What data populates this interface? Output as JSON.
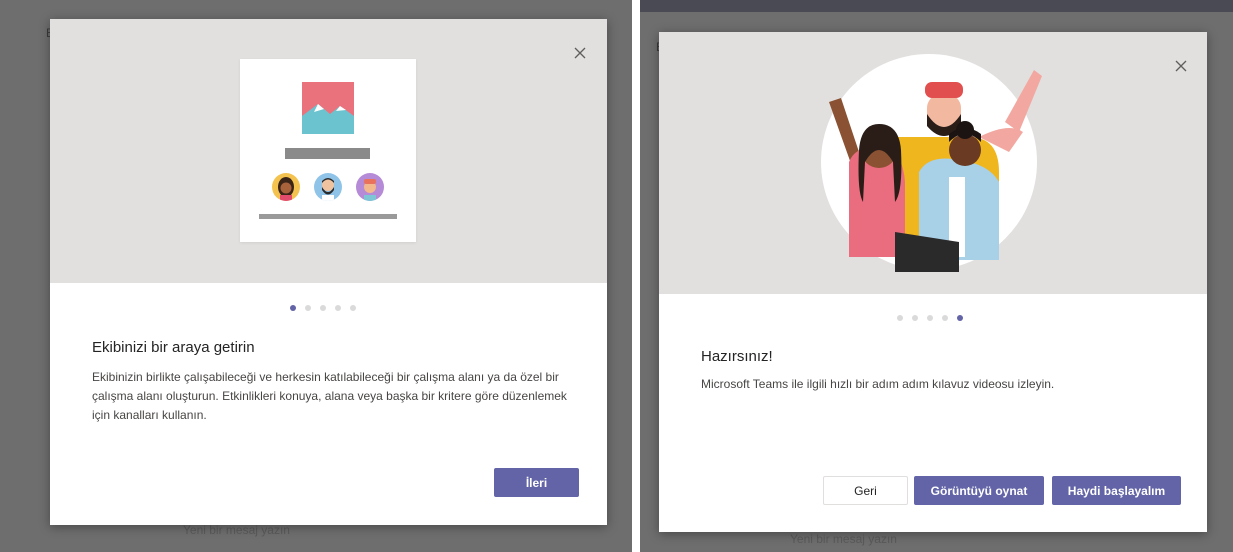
{
  "left": {
    "background_text": "Yeni bir mesaj yazın",
    "dots": [
      true,
      false,
      false,
      false,
      false
    ],
    "title": "Ekibinizi bir araya getirin",
    "body": "Ekibinizin birlikte çalışabileceği ve herkesin katılabileceği bir çalışma alanı ya da özel bir çalışma alanı oluşturun. Etkinlikleri konuya, alana veya başka bir kritere göre düzenlemek için kanalları kullanın.",
    "next_label": "İleri"
  },
  "right": {
    "background_text": "Yeni bir mesaj yazın",
    "dots": [
      false,
      false,
      false,
      false,
      true
    ],
    "title": "Hazırsınız!",
    "body": "Microsoft Teams ile ilgili hızlı bir adım adım kılavuz videosu izleyin.",
    "back_label": "Geri",
    "play_label": "Görüntüyü oynat",
    "start_label": "Haydi başlayalım"
  },
  "colors": {
    "accent": "#6264a7",
    "hero_bg": "#e2e0df",
    "overlay": "#6e6e6e"
  },
  "icons": [
    "close-icon",
    "image-icon",
    "avatar-icon"
  ]
}
